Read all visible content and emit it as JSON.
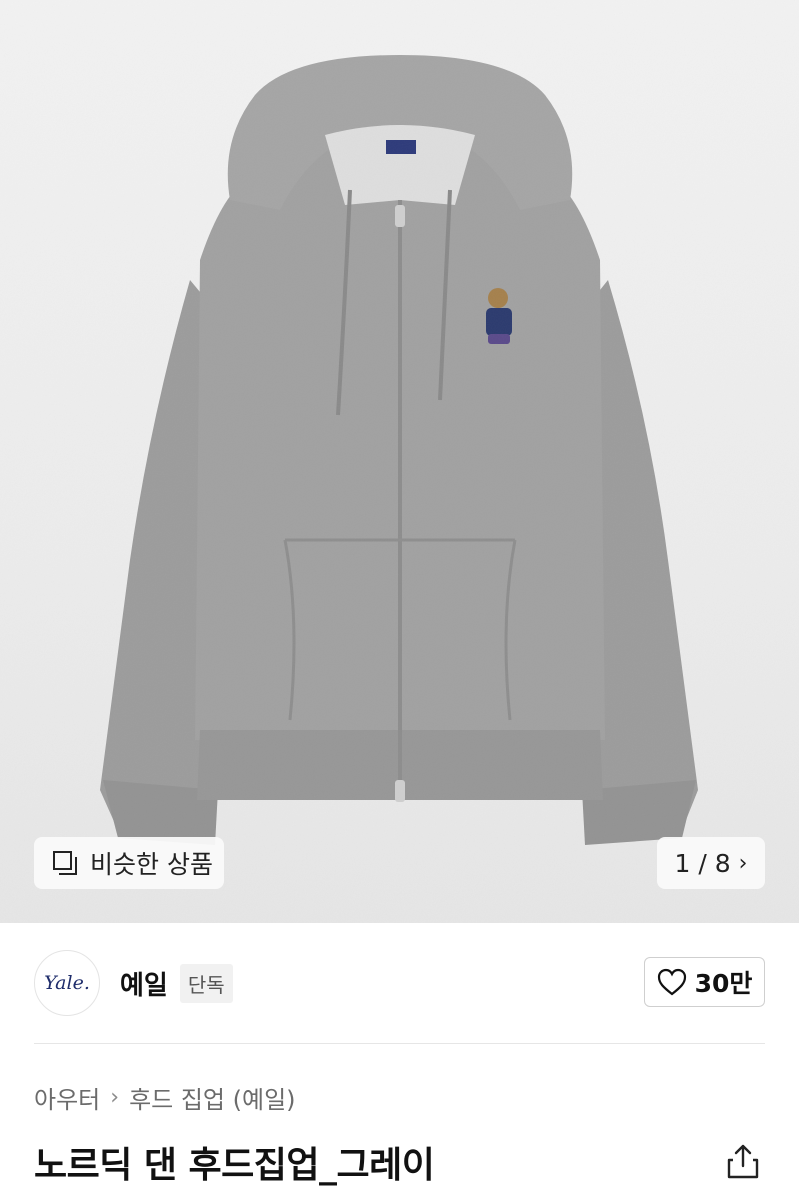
{
  "gallery": {
    "similar_label": "비슷한 상품",
    "similar_icon": "similar-products-icon",
    "counter": "1 / 8",
    "next_icon": "chevron-right-icon"
  },
  "brand": {
    "logo_text": "Yale.",
    "name": "예일",
    "badge": "단독",
    "like_icon": "heart-outline-icon",
    "like_count": "30만"
  },
  "breadcrumb": {
    "items": [
      "아우터",
      "후드 집업 (예일)"
    ],
    "separator_icon": "chevron-right-icon"
  },
  "product": {
    "title": "노르딕 댄 후드집업_그레이",
    "share_icon": "share-icon",
    "color": "#9b9b9b"
  }
}
